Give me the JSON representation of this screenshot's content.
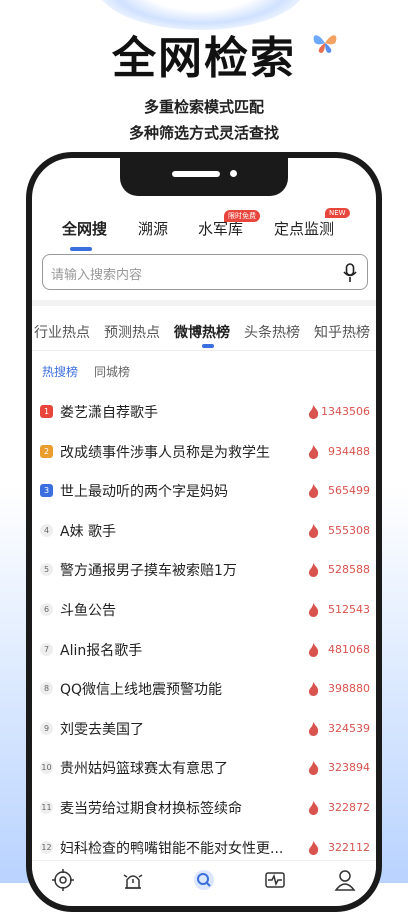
{
  "hero": {
    "title": "全网检索",
    "subtitle_1": "多重检索模式匹配",
    "subtitle_2": "多种筛选方式灵活查找"
  },
  "app": {
    "top_tabs": [
      {
        "label": "全网搜",
        "active": true
      },
      {
        "label": "溯源",
        "active": false
      },
      {
        "label": "水军库",
        "active": false
      },
      {
        "label": "定点监测",
        "active": false
      }
    ],
    "tags": {
      "free": "限时免费",
      "new": "NEW"
    },
    "search": {
      "placeholder": "请输入搜索内容"
    },
    "category_tabs": [
      {
        "label": "行业热点",
        "active": false
      },
      {
        "label": "预测热点",
        "active": false
      },
      {
        "label": "微博热榜",
        "active": true
      },
      {
        "label": "头条热榜",
        "active": false
      },
      {
        "label": "知乎热榜",
        "active": false
      }
    ],
    "sub_tabs": [
      {
        "label": "热搜榜",
        "active": true
      },
      {
        "label": "同城榜",
        "active": false
      }
    ],
    "list": [
      {
        "rank": "1",
        "title": "娄艺潇自荐歌手",
        "heat": "1343506"
      },
      {
        "rank": "2",
        "title": "改成绩事件涉事人员称是为救学生",
        "heat": "934488"
      },
      {
        "rank": "3",
        "title": "世上最动听的两个字是妈妈",
        "heat": "565499"
      },
      {
        "rank": "4",
        "title": "A妹 歌手",
        "heat": "555308"
      },
      {
        "rank": "5",
        "title": "警方通报男子摸车被索赔1万",
        "heat": "528588"
      },
      {
        "rank": "6",
        "title": "斗鱼公告",
        "heat": "512543"
      },
      {
        "rank": "7",
        "title": "Alin报名歌手",
        "heat": "481068"
      },
      {
        "rank": "8",
        "title": "QQ微信上线地震预警功能",
        "heat": "398880"
      },
      {
        "rank": "9",
        "title": "刘雯去美国了",
        "heat": "324539"
      },
      {
        "rank": "10",
        "title": "贵州姑妈篮球赛太有意思了",
        "heat": "323894"
      },
      {
        "rank": "11",
        "title": "麦当劳给过期食材换标签续命",
        "heat": "322872"
      },
      {
        "rank": "12",
        "title": "妇科检查的鸭嘴钳能不能对女性更...",
        "heat": "322112"
      }
    ],
    "bottom_nav": [
      {
        "icon": "target-icon",
        "active": false
      },
      {
        "icon": "alert-icon",
        "active": false
      },
      {
        "icon": "search-icon",
        "active": true
      },
      {
        "icon": "monitor-icon",
        "active": false
      },
      {
        "icon": "user-icon",
        "active": false
      }
    ]
  },
  "colors": {
    "accent": "#3b6fe0",
    "hot": "#d9534f"
  }
}
